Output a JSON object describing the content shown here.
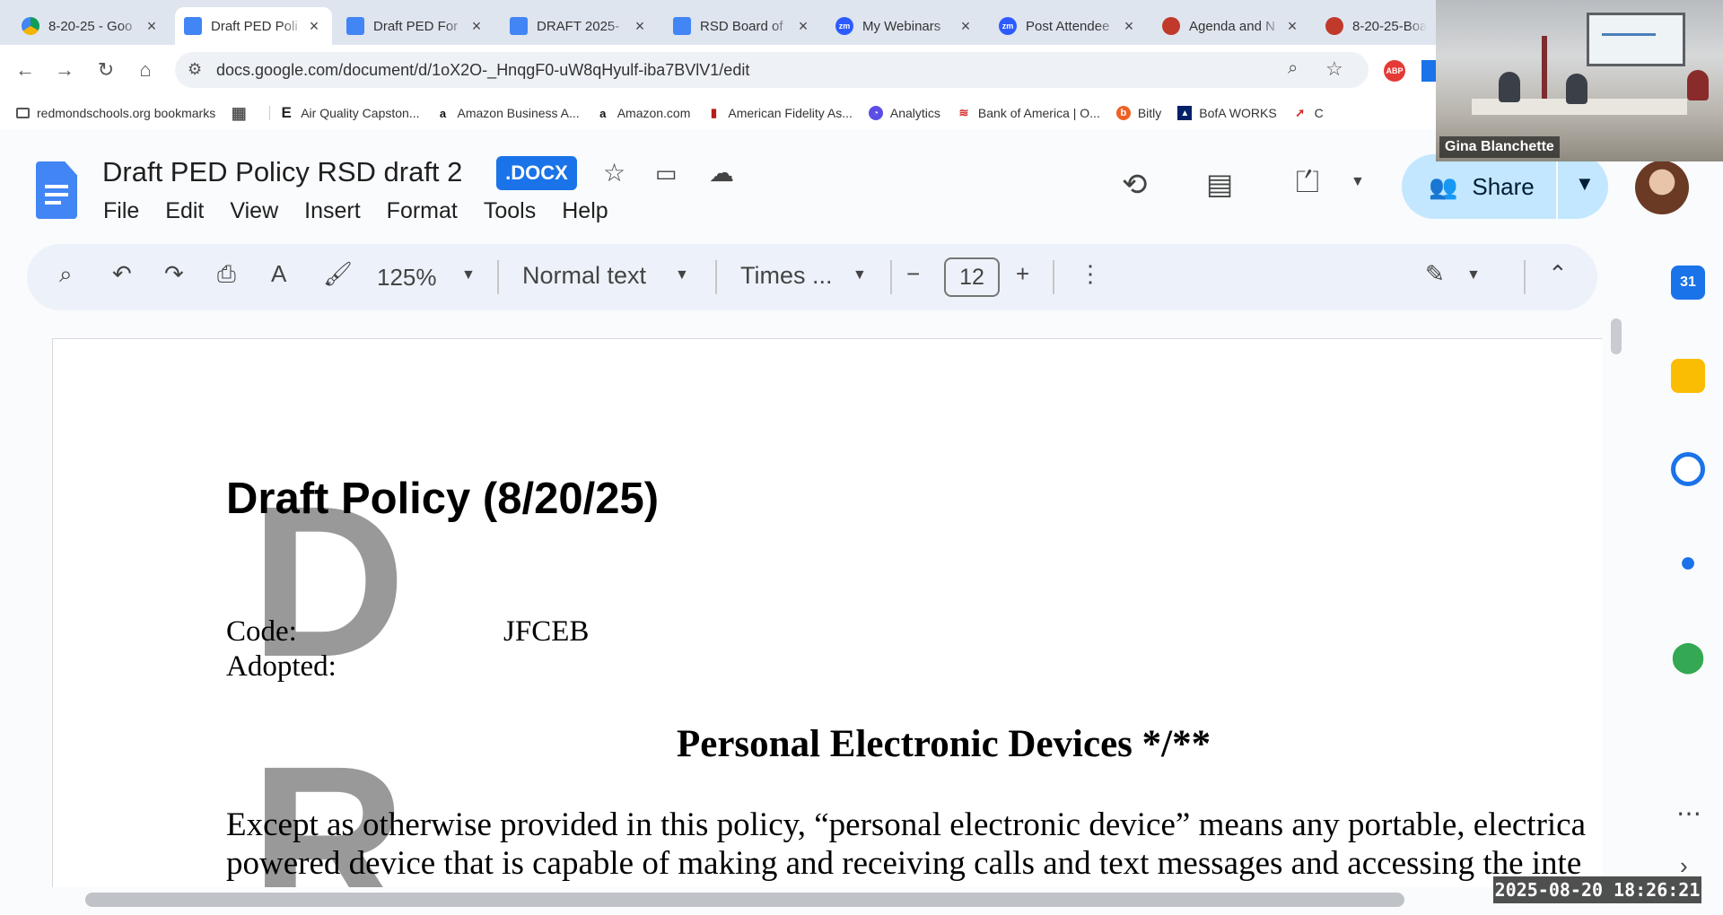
{
  "browser": {
    "tabs": [
      {
        "title": "8-20-25 - Goo",
        "favicon": "drive-icon",
        "active": false
      },
      {
        "title": "Draft PED Poli",
        "favicon": "docs-icon",
        "active": true
      },
      {
        "title": "Draft PED For",
        "favicon": "docs-icon",
        "active": false
      },
      {
        "title": "DRAFT 2025-",
        "favicon": "docs-icon",
        "active": false
      },
      {
        "title": "RSD Board of",
        "favicon": "docs-icon",
        "active": false
      },
      {
        "title": "My Webinars",
        "favicon": "zoom-icon",
        "active": false
      },
      {
        "title": "Post Attendee",
        "favicon": "zoom-icon",
        "active": false
      },
      {
        "title": "Agenda and N",
        "favicon": "boarddocs-icon",
        "active": false
      },
      {
        "title": "8-20-25-Boar",
        "favicon": "boarddocs-icon",
        "active": false
      }
    ],
    "url": "docs.google.com/document/d/1oX2O-_HnqgF0-uW8qHyulf-iba7BVlV1/edit",
    "zoom_favicon_label": "zm",
    "bookmarks": [
      {
        "label": "redmondschools.org bookmarks",
        "icon": "folder-icon"
      },
      {
        "label": "",
        "icon": "apps-grid-icon"
      },
      {
        "label": "Air Quality Capston...",
        "icon": "e-logo-icon"
      },
      {
        "label": "Amazon Business A...",
        "icon": "amazon-icon"
      },
      {
        "label": "Amazon.com",
        "icon": "amazon-icon"
      },
      {
        "label": "American Fidelity As...",
        "icon": "bars-icon"
      },
      {
        "label": "Analytics",
        "icon": "analytics-icon"
      },
      {
        "label": "Bank of America | O...",
        "icon": "bofa-icon"
      },
      {
        "label": "Bitly",
        "icon": "bitly-icon"
      },
      {
        "label": "BofA WORKS",
        "icon": "bofa-works-icon"
      },
      {
        "label": "C",
        "icon": "red-arrow-icon"
      }
    ]
  },
  "docs": {
    "title": "Draft PED Policy RSD draft 2",
    "file_badge": ".DOCX",
    "menu": [
      "File",
      "Edit",
      "View",
      "Insert",
      "Format",
      "Tools",
      "Help"
    ],
    "share_label": "Share",
    "toolbar": {
      "zoom": "125%",
      "style": "Normal text",
      "font": "Times ...",
      "font_size": "12"
    }
  },
  "document": {
    "watermark_letters": [
      "D",
      "R"
    ],
    "heading": "Draft Policy (8/20/25)",
    "code_label": "Code:",
    "code_value": "JFCEB",
    "adopted_label": "Adopted:",
    "policy_title": "Personal Electronic Devices */**",
    "body_lines": [
      "Except as otherwise provided in this policy, “personal electronic device” means any portable, electrica",
      "powered device that is capable of making and receiving calls and text messages and accessing the inte"
    ]
  },
  "video_overlay": {
    "participant_name": "Gina Blanchette"
  },
  "timestamp": "2025-08-20  18:26:21",
  "colors": {
    "accent_blue": "#1a73e8",
    "share_bg": "#c2e7ff",
    "watermark_gray": "#999999"
  }
}
